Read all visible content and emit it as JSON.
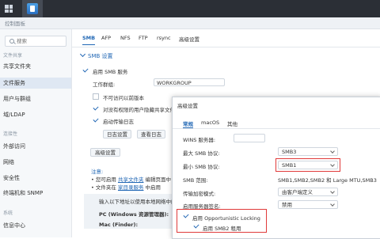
{
  "window": {
    "title": "控制面板"
  },
  "sidebar": {
    "search_placeholder": "搜索",
    "groups": [
      {
        "label": "文件共享"
      },
      {
        "label": "连接性"
      },
      {
        "label": "系统"
      }
    ],
    "items": [
      {
        "label": "共享文件夹"
      },
      {
        "label": "文件服务"
      },
      {
        "label": "用户与群组"
      },
      {
        "label": "域/LDAP"
      },
      {
        "label": "外部访问"
      },
      {
        "label": "网络"
      },
      {
        "label": "安全性"
      },
      {
        "label": "终端机和 SNMP"
      },
      {
        "label": "信息中心"
      }
    ]
  },
  "main": {
    "tabs": [
      "SMB",
      "AFP",
      "NFS",
      "FTP",
      "rsync",
      "高级设置"
    ],
    "section_title": "SMB 设置",
    "enable_smb": "启用 SMB 服务",
    "workgroup_label": "工作群组:",
    "workgroup_value": "WORKGROUP",
    "hide_option": "不可访问以前版本",
    "hide_shared": "对没有权限的用户隐藏共享文件夹",
    "enable_log": "启动传输日志",
    "log_settings_btn": "日志设置",
    "view_log_btn": "查看日志",
    "advanced_btn": "高级设置",
    "note_title": "注意:",
    "note_line1_pre": "• 您可启用 ",
    "note_line1_link": "共享文件夹",
    "note_line1_post": " 编辑页面中",
    "note_line2_pre": "• 文件夹在 ",
    "note_line2_link": "家目录服务",
    "note_line2_post": " 中启用",
    "note_line3": "输入以下地址以使用本地网络中的",
    "pc_label": "PC (Windows 资源管理器):",
    "mac_label": "Mac (Finder):"
  },
  "dialog": {
    "title": "高级设置",
    "tabs": [
      "常规",
      "macOS",
      "其他"
    ],
    "wins_label": "WINS 服务器:",
    "max_smb_label": "最大 SMB 协议:",
    "max_smb_value": "SMB3",
    "min_smb_label": "最小 SMB 协议:",
    "min_smb_value": "SMB1",
    "range_label": "SMB 范围:",
    "range_value": "SMB1,SMB2,SMB2 和 Large MTU,SMB3",
    "transport_label": "传输加密模式:",
    "transport_value": "由客户端定义",
    "server_sign_label": "启用服务器签名:",
    "server_sign_value": "禁用",
    "oplock_label": "启用 Opportunistic Locking",
    "smb2_lease_label": "启用 SMB2 租用"
  }
}
